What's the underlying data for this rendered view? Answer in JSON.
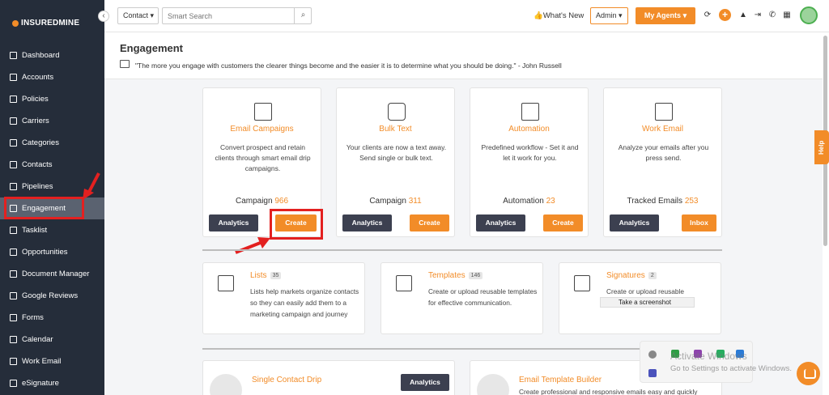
{
  "brand": {
    "name": "INSUREDMINE"
  },
  "sidebar": {
    "items": [
      {
        "label": "Dashboard",
        "icon": "dashboard-icon"
      },
      {
        "label": "Accounts",
        "icon": "accounts-icon"
      },
      {
        "label": "Policies",
        "icon": "policies-icon"
      },
      {
        "label": "Carriers",
        "icon": "carriers-icon"
      },
      {
        "label": "Categories",
        "icon": "categories-icon"
      },
      {
        "label": "Contacts",
        "icon": "contacts-icon"
      },
      {
        "label": "Pipelines",
        "icon": "pipelines-icon"
      },
      {
        "label": "Engagement",
        "icon": "megaphone-icon",
        "active": true
      },
      {
        "label": "Tasklist",
        "icon": "tasklist-icon"
      },
      {
        "label": "Opportunities",
        "icon": "opportunities-icon"
      },
      {
        "label": "Document Manager",
        "icon": "document-icon"
      },
      {
        "label": "Google Reviews",
        "icon": "google-icon"
      },
      {
        "label": "Forms",
        "icon": "forms-icon"
      },
      {
        "label": "Calendar",
        "icon": "calendar-icon"
      },
      {
        "label": "Work Email",
        "icon": "mail-icon"
      },
      {
        "label": "eSignature",
        "icon": "signature-icon"
      }
    ]
  },
  "topbar": {
    "contact_select": "Contact",
    "search_placeholder": "Smart Search",
    "whats_new": "What's New",
    "admin": "Admin",
    "my_agents": "My Agents",
    "plus": "+"
  },
  "header": {
    "title": "Engagement",
    "quote": "\"The more you engage with customers the clearer things become and the easier it is to determine what you should be doing.\" - John Russell"
  },
  "cards": [
    {
      "title": "Email Campaigns",
      "desc": "Convert prospect and retain clients through smart email drip campaigns.",
      "count_label": "Campaign",
      "count": "966",
      "btn_left": "Analytics",
      "btn_right": "Create"
    },
    {
      "title": "Bulk Text",
      "desc": "Your clients are now a text away. Send single or bulk text.",
      "count_label": "Campaign",
      "count": "311",
      "btn_left": "Analytics",
      "btn_right": "Create"
    },
    {
      "title": "Automation",
      "desc": "Predefined workflow - Set it and let it work for you.",
      "count_label": "Automation",
      "count": "23",
      "btn_left": "Analytics",
      "btn_right": "Create"
    },
    {
      "title": "Work Email",
      "desc": "Analyze your emails after you press send.",
      "count_label": "Tracked Emails",
      "count": "253",
      "btn_left": "Analytics",
      "btn_right": "Inbox"
    }
  ],
  "tiles": [
    {
      "title": "Lists",
      "badge": "35",
      "desc": "Lists help markets organize contacts so they can easily add them to a marketing campaign and journey"
    },
    {
      "title": "Templates",
      "badge": "146",
      "desc": "Create or upload reusable templates for effective communication."
    },
    {
      "title": "Signatures",
      "badge": "2",
      "desc": "Create or upload reusable"
    }
  ],
  "screenshot_tip": "Take a screenshot",
  "bottom": {
    "single_drip": "Single Contact Drip",
    "single_drip_btn": "Analytics",
    "template_builder": "Email Template Builder",
    "template_builder_desc": "Create professional and responsive emails easy and quickly"
  },
  "help_tab": "Help",
  "watermark": {
    "line1": "Activate Windows",
    "line2": "Go to Settings to activate Windows."
  },
  "colors": {
    "accent": "#f28c28",
    "sidebar_bg": "#252d3a",
    "dark_button": "#3c4050",
    "annotation_red": "#e32020"
  }
}
